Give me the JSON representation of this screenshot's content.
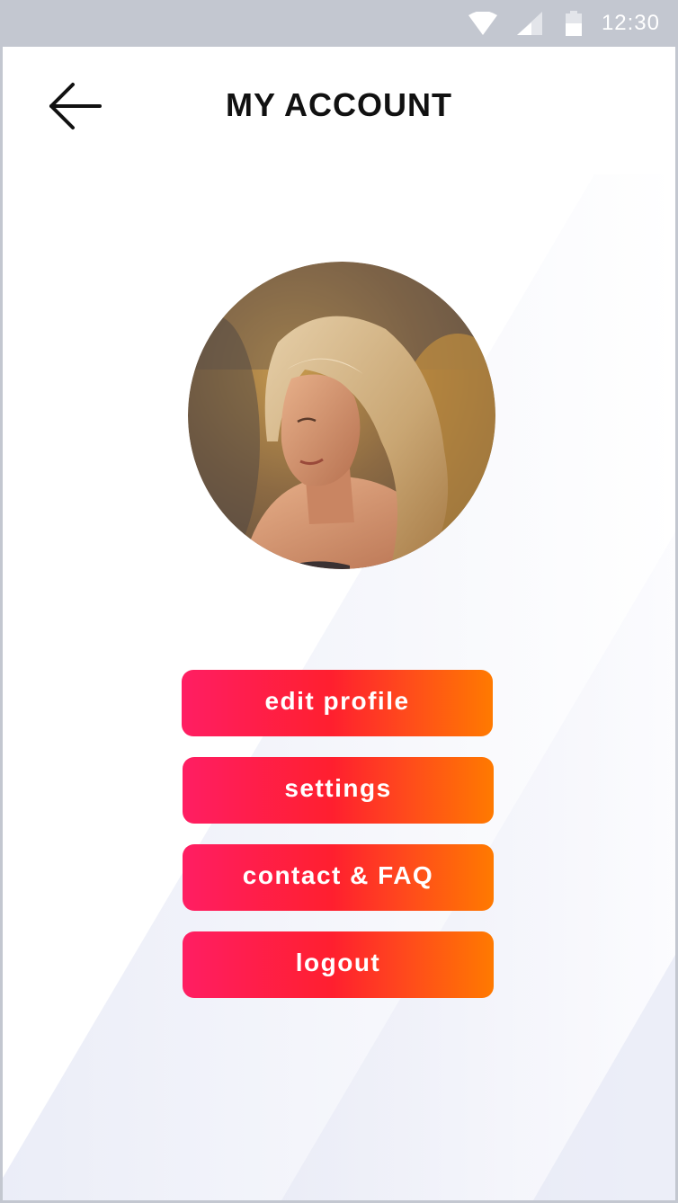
{
  "status_bar": {
    "time": "12:30",
    "icons": [
      "wifi-icon",
      "cell-signal-icon",
      "battery-icon"
    ]
  },
  "header": {
    "title": "MY ACCOUNT",
    "back_icon": "arrow-left-icon"
  },
  "profile": {
    "avatar": "profile-photo"
  },
  "menu": {
    "items": [
      {
        "label": "edit profile"
      },
      {
        "label": "settings"
      },
      {
        "label": "contact & FAQ"
      },
      {
        "label": "logout"
      }
    ]
  },
  "colors": {
    "status_bar": "#c3c7d0",
    "gradient_start": "#ff1e63",
    "gradient_mid": "#ff1f2f",
    "gradient_end": "#ff7a00",
    "title": "#111111",
    "background_accent": "#e9ebf7"
  }
}
